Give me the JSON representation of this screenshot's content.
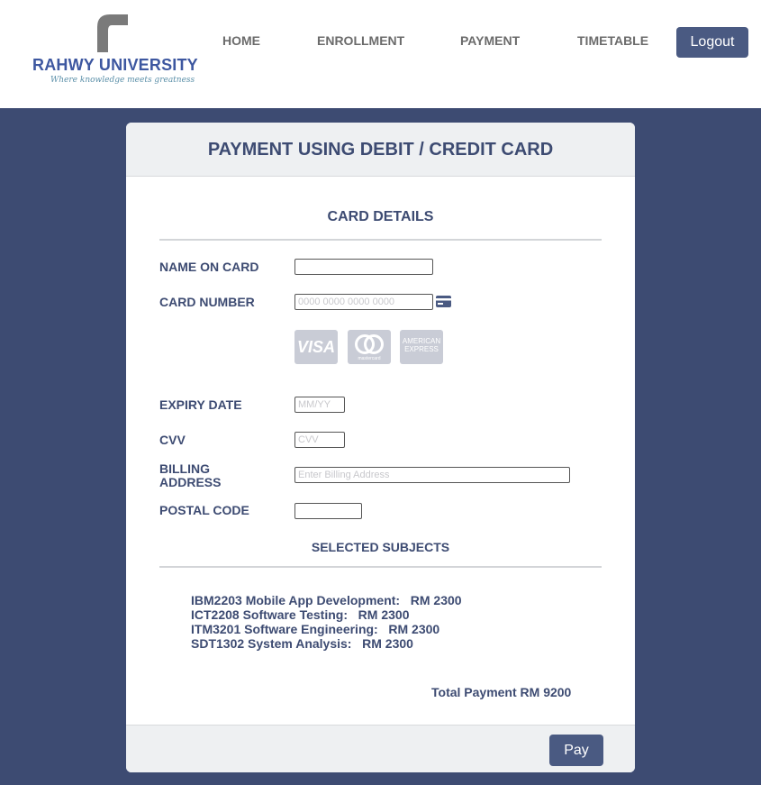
{
  "header": {
    "logo_title": "RAHWY UNIVERSITY",
    "logo_tagline": "Where knowledge meets greatness",
    "nav": [
      "HOME",
      "ENROLLMENT",
      "PAYMENT",
      "TIMETABLE"
    ],
    "logout_label": "Logout"
  },
  "payment": {
    "title": "PAYMENT USING DEBIT / CREDIT CARD",
    "card_details_heading": "CARD DETAILS",
    "fields": {
      "name_label": "NAME ON CARD",
      "name_value": "",
      "number_label": "CARD NUMBER",
      "number_placeholder": "0000 0000 0000 0000",
      "expiry_label": "EXPIRY DATE",
      "expiry_placeholder": "MM/YY",
      "cvv_label": "CVV",
      "cvv_placeholder": "CVV",
      "billing_label_line1": "BILLING",
      "billing_label_line2": "ADDRESS",
      "billing_placeholder": "Enter Billing Address",
      "postal_label": "POSTAL CODE",
      "postal_value": ""
    },
    "card_brands": {
      "visa": "VISA",
      "mastercard": "mastercard",
      "amex_line1": "AMERICAN",
      "amex_line2": "EXPRESS"
    },
    "subjects_heading": "SELECTED SUBJECTS",
    "subjects": [
      "IBM2203 Mobile App Development:   RM 2300",
      "ICT2208 Software Testing:   RM 2300",
      "ITM3201 Software Engineering:   RM 2300",
      "SDT1302 System Analysis:   RM 2300"
    ],
    "total": "Total Payment RM 9200",
    "pay_label": "Pay"
  },
  "colors": {
    "page_background": "#3d4b72",
    "accent": "#4a5a82",
    "text_primary": "#3d4b72"
  }
}
